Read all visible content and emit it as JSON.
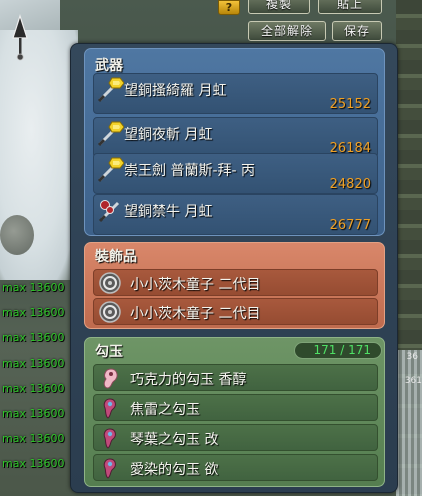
{
  "toolbar": {
    "help_label": "?",
    "copy_label": "複製",
    "paste_label": "貼上",
    "unequip_all_label": "全部解除",
    "save_label": "保存"
  },
  "side_list": {
    "items": [
      "max 13600",
      "max 13600",
      "max 13600",
      "max 13600",
      "max 13600",
      "max 13600",
      "max 13600",
      "max 13600"
    ],
    "color": "#2fc52a"
  },
  "background": {
    "right_text_1": "36",
    "right_text_2": "361"
  },
  "weapons": {
    "title": "武器",
    "items": [
      {
        "name": "望銅搔綺羅 月虹",
        "value": "25152",
        "icon": "sword-gem-icon"
      },
      {
        "name": "望銅夜斬 月虹",
        "value": "26184",
        "icon": "sword-gem-icon"
      },
      {
        "name": "崇王劍 普蘭斯-拜- 丙",
        "value": "24820",
        "icon": "sword-gem-icon"
      },
      {
        "name": "望銅禁牛 月虹",
        "value": "26777",
        "icon": "red-sword-icon"
      }
    ]
  },
  "accessories": {
    "title": "裝飾品",
    "items": [
      {
        "name": "小小茨木童子 二代目",
        "icon": "ring-icon"
      },
      {
        "name": "小小茨木童子 二代目",
        "icon": "ring-icon"
      }
    ]
  },
  "jewels": {
    "title": "勾玉",
    "count": "171 / 171",
    "items": [
      {
        "name": "巧克力的勾玉 香醇",
        "icon": "magatama-pink-icon"
      },
      {
        "name": "焦雷之勾玉",
        "icon": "magatama-blue-icon"
      },
      {
        "name": "琴葉之勾玉 改",
        "icon": "magatama-blue-icon"
      },
      {
        "name": "愛染的勾玉 欲",
        "icon": "magatama-blue-icon"
      }
    ]
  },
  "colors": {
    "weapon_value": "#f0a024",
    "jewel_counter": "#4fe065",
    "weapon_section": "#4f77a2",
    "accessory_section": "#d9876a",
    "jewel_section": "#6e9566"
  }
}
